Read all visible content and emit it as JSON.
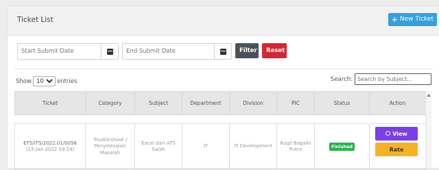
{
  "header": {
    "title": "Ticket List",
    "new_ticket_label": "New Ticket"
  },
  "filters": {
    "start_placeholder": "Start Submit Date",
    "end_placeholder": "End Submit Date",
    "filter_label": "Filter",
    "reset_label": "Reset"
  },
  "length": {
    "show_label": "Show",
    "selected": "10",
    "entries_label": "entries"
  },
  "search": {
    "label": "Search:",
    "placeholder": "Search by Subject..."
  },
  "table": {
    "columns": [
      "Ticket",
      "Category",
      "Subject",
      "Department",
      "Division",
      "PIC",
      "Status",
      "Action"
    ],
    "rows": [
      {
        "ticket_id": "ETS/ITS/2022.01/0056",
        "ticket_date": "(13-Jan-2022 09:24)",
        "category": "Troubleshoot / Penyelesaian Masalah",
        "subject": "Excel dari ATS Salah",
        "department": "IT",
        "division": "IT Development",
        "pic": "Ragil Bagaiki Putra",
        "status": "Finished",
        "view_label": "View",
        "rate_label": "Rate"
      }
    ]
  },
  "colors": {
    "new_ticket": "#33a1de",
    "filter": "#4b5257",
    "reset": "#d9252f",
    "finished": "#2bb24c",
    "view": "#7a3fe8",
    "rate": "#f5b324"
  }
}
